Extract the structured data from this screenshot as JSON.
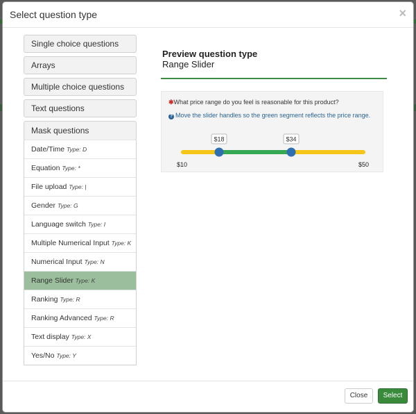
{
  "dialog": {
    "title": "Select question type",
    "close_glyph": "×"
  },
  "categories": [
    "Single choice questions",
    "Arrays",
    "Multiple choice questions",
    "Text questions",
    "Mask questions"
  ],
  "mask_items": [
    {
      "label": "Date/Time",
      "type": "Type: D"
    },
    {
      "label": "Equation",
      "type": "Type: *"
    },
    {
      "label": "File upload",
      "type": "Type: |"
    },
    {
      "label": "Gender",
      "type": "Type: G"
    },
    {
      "label": "Language switch",
      "type": "Type: I"
    },
    {
      "label": "Multiple Numerical Input",
      "type": "Type: K"
    },
    {
      "label": "Numerical Input",
      "type": "Type: N"
    },
    {
      "label": "Range Slider",
      "type": "Type: K",
      "active": true
    },
    {
      "label": "Ranking",
      "type": "Type: R"
    },
    {
      "label": "Ranking Advanced",
      "type": "Type: R"
    },
    {
      "label": "Text display",
      "type": "Type: X"
    },
    {
      "label": "Yes/No",
      "type": "Type: Y"
    }
  ],
  "preview": {
    "heading": "Preview question type",
    "type_name": "Range Slider",
    "question": "What price range do you feel is reasonable for this product?",
    "required_mark": "✱",
    "help": "Move the slider handles so the green segment reflects the price range.",
    "help_icon": "?",
    "slider": {
      "min": 10,
      "max": 50,
      "low": 18,
      "high": 34,
      "min_label": "$10",
      "max_label": "$50",
      "low_label": "$18",
      "high_label": "$34",
      "track_color": "#f5c518",
      "range_color": "#34a853",
      "handle_color": "#2f6fb0"
    }
  },
  "footer": {
    "close_label": "Close",
    "select_label": "Select"
  }
}
